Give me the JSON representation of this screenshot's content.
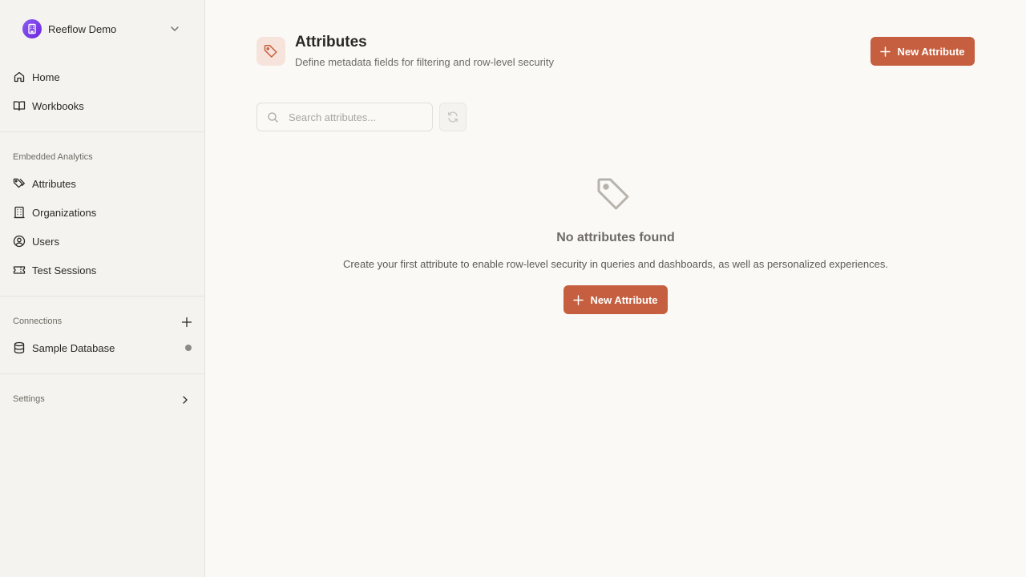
{
  "workspace": {
    "name": "Reeflow Demo"
  },
  "nav": {
    "home": "Home",
    "workbooks": "Workbooks",
    "embedded_section": "Embedded Analytics",
    "attributes": "Attributes",
    "organizations": "Organizations",
    "users": "Users",
    "test_sessions": "Test Sessions",
    "connections_section": "Connections",
    "sample_database": "Sample Database",
    "settings": "Settings"
  },
  "header": {
    "title": "Attributes",
    "subtitle": "Define metadata fields for filtering and row-level security",
    "new_button": "New Attribute"
  },
  "search": {
    "placeholder": "Search attributes..."
  },
  "empty_state": {
    "title": "No attributes found",
    "description": "Create your first attribute to enable row-level security in queries and dashboards, as well as personalized experiences.",
    "button": "New Attribute"
  },
  "colors": {
    "accent": "#c65f3f",
    "workspace_logo": "#7c3aed",
    "sidebar_bg": "#f4f3ef",
    "page_bg": "#faf9f6"
  },
  "icons": {
    "workspace": "building-icon",
    "home": "home-icon",
    "workbooks": "book-open-icon",
    "attributes": "tags-icon",
    "organizations": "building-office-icon",
    "users": "user-circle-icon",
    "test_sessions": "ticket-icon",
    "sample_database": "database-icon",
    "header": "tag-icon",
    "search": "search-icon",
    "refresh": "refresh-icon",
    "empty": "tag-icon"
  }
}
